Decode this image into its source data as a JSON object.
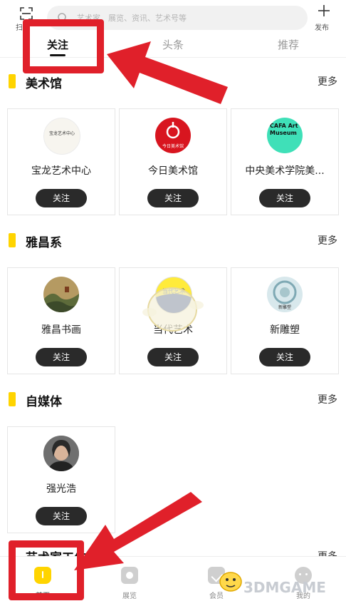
{
  "header": {
    "scan_label": "扫",
    "search_placeholder": "艺术家、展览、资讯、艺术号等",
    "publish_label": "发布"
  },
  "tabs": [
    {
      "label": "关注",
      "active": true
    },
    {
      "label": "头条",
      "active": false
    },
    {
      "label": "推荐",
      "active": false
    }
  ],
  "sections": [
    {
      "title": "美术馆",
      "more": "更多",
      "items": [
        {
          "name": "宝龙艺术中心",
          "logo_text": "宝龙艺术中心",
          "button": "关注"
        },
        {
          "name": "今日美术馆",
          "logo_text": "今日美术馆",
          "button": "关注"
        },
        {
          "name": "中央美术学院美...",
          "logo_text": "CAFA Art Museum",
          "button": "关注"
        }
      ]
    },
    {
      "title": "雅昌系",
      "more": "更多",
      "items": [
        {
          "name": "雅昌书画",
          "button": "关注"
        },
        {
          "name": "当代艺术",
          "logo_text": "当代艺术",
          "button": "关注"
        },
        {
          "name": "新雕塑",
          "logo_text": "新雕塑",
          "button": "关注"
        }
      ]
    },
    {
      "title": "自媒体",
      "more": "更多",
      "items": [
        {
          "name": "强光浩",
          "button": "关注"
        }
      ]
    }
  ],
  "partial_section": {
    "title": "艺术家工作室",
    "more": "更多"
  },
  "bottom_nav": [
    {
      "label": "首页",
      "icon": "home-icon",
      "active": true
    },
    {
      "label": "展览",
      "icon": "exhibition-icon",
      "active": false
    },
    {
      "label": "会员",
      "icon": "member-icon",
      "active": false
    },
    {
      "label": "我的",
      "icon": "profile-icon",
      "active": false
    }
  ],
  "watermark": "3DMGAME",
  "colors": {
    "accent": "#ffd400",
    "button_bg": "#2a2a2a",
    "annotation": "#e0202a"
  }
}
